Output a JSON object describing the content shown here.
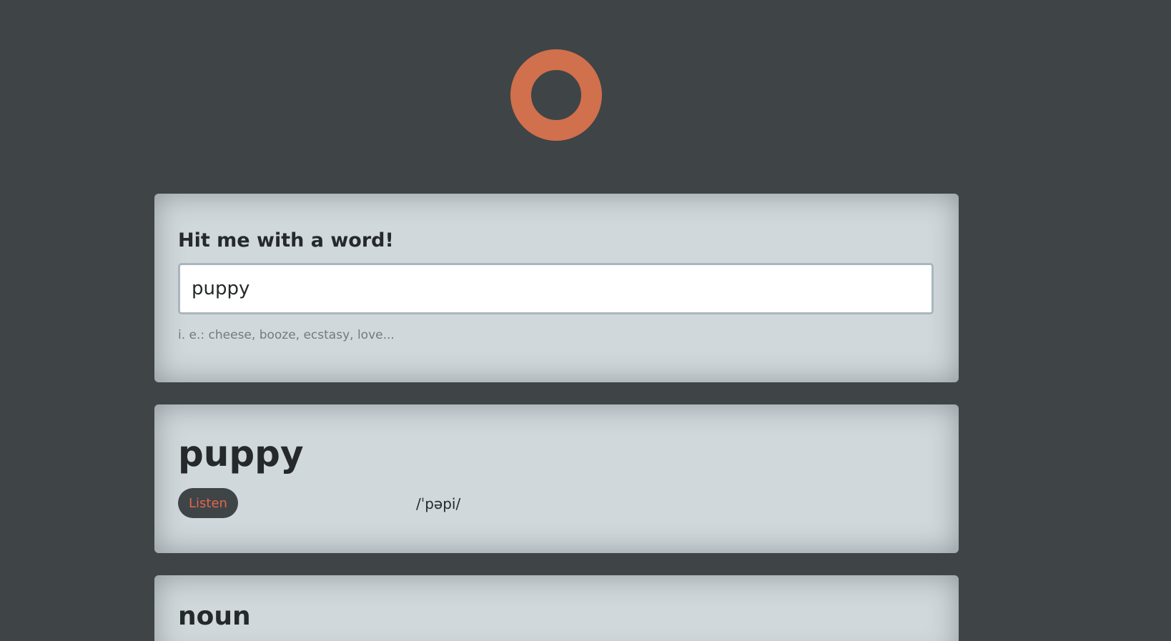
{
  "logo": {
    "icon": "ring-logo-icon",
    "color": "#d0704c"
  },
  "search": {
    "label": "Hit me with a word!",
    "value": "puppy",
    "hint": "i. e.: cheese, booze, ecstasy, love..."
  },
  "result": {
    "word": "puppy",
    "listen_label": "Listen",
    "phonetic": "/ˈpəpi/"
  },
  "meaning": {
    "part_of_speech": "noun"
  },
  "colors": {
    "background": "#3f4447",
    "card": "#d0d8dc",
    "accent": "#e0684a"
  }
}
